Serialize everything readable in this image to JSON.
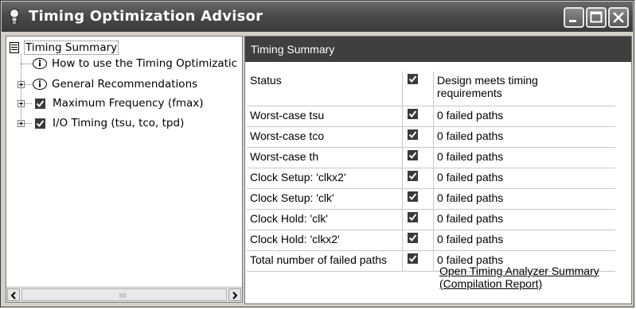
{
  "window": {
    "title": "Timing Optimization Advisor"
  },
  "tree": {
    "root": "Timing Summary",
    "items": [
      {
        "label": "How to use the Timing Optimizatic"
      },
      {
        "label": "General Recommendations"
      },
      {
        "label": "Maximum Frequency (fmax)"
      },
      {
        "label": "I/O Timing (tsu, tco, tpd)"
      }
    ]
  },
  "panel": {
    "header": "Timing Summary",
    "rows": [
      {
        "label": "Status",
        "value_line1": "Design meets timing",
        "value_line2": "requirements"
      },
      {
        "label": "Worst-case tsu",
        "value": "0  failed paths"
      },
      {
        "label": "Worst-case tco",
        "value": "0  failed paths"
      },
      {
        "label": "Worst-case th",
        "value": "0  failed paths"
      },
      {
        "label": "Clock Setup: 'clkx2'",
        "value": "0  failed paths"
      },
      {
        "label": "Clock Setup: 'clk'",
        "value": "0  failed paths"
      },
      {
        "label": "Clock Hold: 'clk'",
        "value": "0  failed paths"
      },
      {
        "label": "Clock Hold: 'clkx2'",
        "value": "0  failed paths"
      },
      {
        "label": "Total number of failed paths",
        "value": "0  failed paths"
      }
    ],
    "link_line1": "Open Timing Analyzer Summary",
    "link_line2": "(Compilation Report)"
  },
  "colors": {
    "titlebar": "#4a4a4a",
    "header": "#3f3f3f"
  }
}
